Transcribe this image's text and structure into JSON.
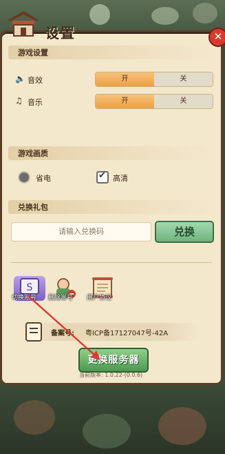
{
  "title": "设置",
  "sections": {
    "game_settings": "游戏设置",
    "graphics": "游戏画质",
    "redeem": "兑换礼包"
  },
  "sound_effects": {
    "label": "音效",
    "on": "开",
    "off": "关"
  },
  "music": {
    "label": "音乐",
    "on": "开",
    "off": "关"
  },
  "graphics_options": {
    "power_saving": "省电",
    "hd": "高清"
  },
  "redeem_box": {
    "placeholder": "请输入兑换码",
    "button": "兑换"
  },
  "actions": [
    "切换账号",
    "删除账号",
    "用户协议"
  ],
  "icp": {
    "label": "备案号:",
    "value": "粤ICP备17127047号-42A"
  },
  "server_button": "更换服务器",
  "version": "当前版本: 1.0.22-(0.0.6)",
  "colors": {
    "toggle_on": "#f0a850",
    "accent_green": "#4a9a4f",
    "close_red": "#d83a2e"
  },
  "icons": {
    "sound": "speaker-icon",
    "music": "music-note-icon",
    "close": "close-icon",
    "switch": "switch-account-icon",
    "delete": "delete-account-icon",
    "agreement": "scroll-icon"
  }
}
